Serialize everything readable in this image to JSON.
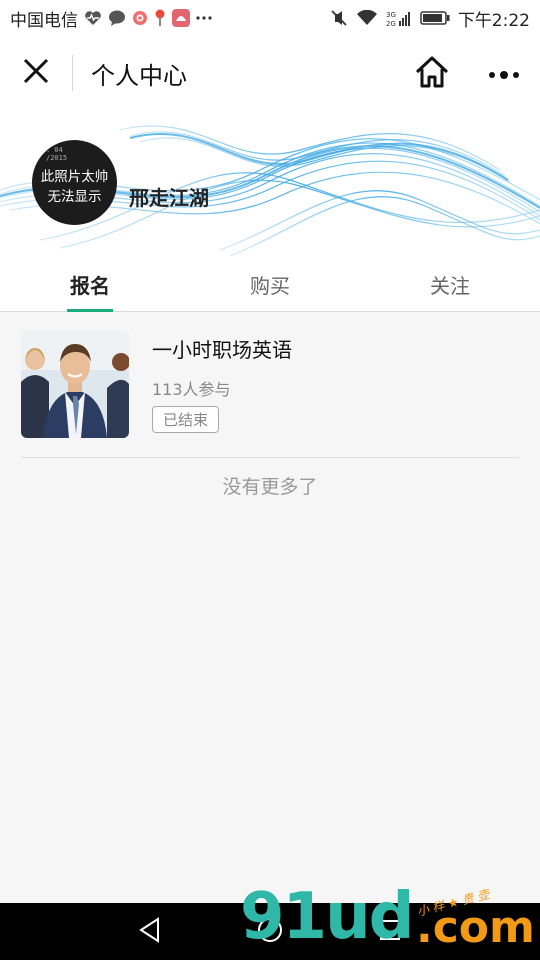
{
  "status_bar": {
    "carrier": "中国电信",
    "time": "下午2:22",
    "network": "3G 2G",
    "icons": [
      "heart-pulse-icon",
      "chat-bubble-icon",
      "weibo-icon",
      "pin-icon",
      "app-icon",
      "more-dots-icon",
      "mute-icon",
      "wifi-icon",
      "signal-icon",
      "battery-icon"
    ]
  },
  "nav": {
    "title": "个人中心",
    "close_icon": "close-icon",
    "home_icon": "home-icon",
    "more_icon": "more-icon"
  },
  "profile": {
    "avatar_top_text": ": 04\n/2015",
    "avatar_line1": "此照片太帅",
    "avatar_line2": "无法显示",
    "username": "邢走江湖"
  },
  "tabs": [
    {
      "label": "报名",
      "active": true
    },
    {
      "label": "购买",
      "active": false
    },
    {
      "label": "关注",
      "active": false
    }
  ],
  "courses": [
    {
      "title": "一小时职场英语",
      "participants": "113人参与",
      "status": "已结束"
    }
  ],
  "list_end_text": "没有更多了",
  "system_nav": {
    "back_icon": "back-triangle-icon",
    "home_icon": "home-circle-icon",
    "recents_icon": "recents-square-icon"
  },
  "watermark": {
    "main": "91ud",
    "suffix": ".com",
    "tagline": "小 样 ★ 贵 壶"
  },
  "colors": {
    "accent": "#1aad7b",
    "wave": "#5fb8ea",
    "watermark_teal": "#2fb8a8",
    "watermark_orange": "#f29a16"
  }
}
